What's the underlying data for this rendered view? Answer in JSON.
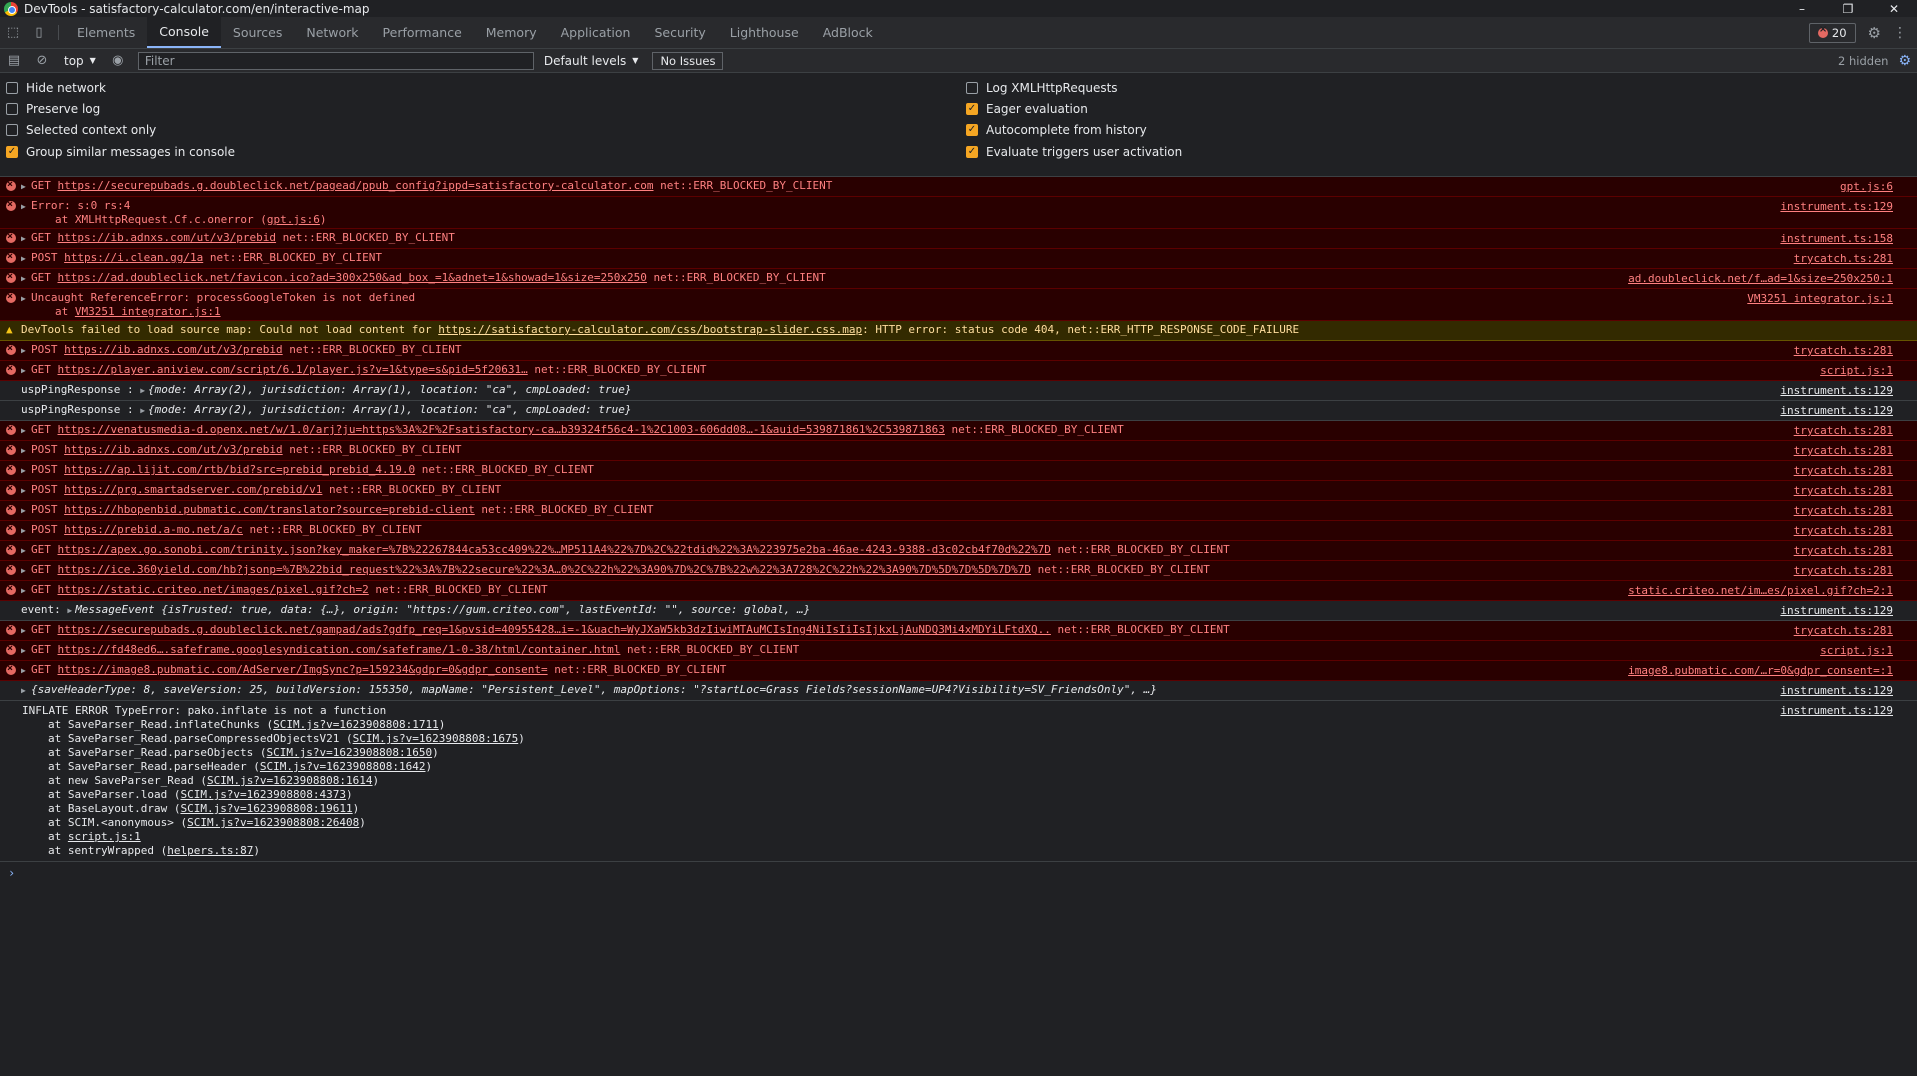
{
  "window": {
    "title": "DevTools - satisfactory-calculator.com/en/interactive-map",
    "controls": [
      "–",
      "❐",
      "✕"
    ]
  },
  "tabs": [
    "Elements",
    "Console",
    "Sources",
    "Network",
    "Performance",
    "Memory",
    "Application",
    "Security",
    "Lighthouse",
    "AdBlock"
  ],
  "active_tab": "Console",
  "error_count": "20",
  "toolbar": {
    "context": "top",
    "filter_placeholder": "Filter",
    "levels": "Default levels",
    "issues": "No Issues",
    "hidden": "2 hidden"
  },
  "settings": {
    "left": [
      {
        "label": "Hide network",
        "checked": false
      },
      {
        "label": "Preserve log",
        "checked": false
      },
      {
        "label": "Selected context only",
        "checked": false
      },
      {
        "label": "Group similar messages in console",
        "checked": true
      }
    ],
    "right": [
      {
        "label": "Log XMLHttpRequests",
        "checked": false
      },
      {
        "label": "Eager evaluation",
        "checked": true
      },
      {
        "label": "Autocomplete from history",
        "checked": true
      },
      {
        "label": "Evaluate triggers user activation",
        "checked": true
      }
    ]
  },
  "console": [
    {
      "type": "error",
      "method": "GET",
      "url": "https://securepubads.g.doubleclick.net/pagead/ppub_config?ippd=satisfactory-calculator.com",
      "tail": " net::ERR_BLOCKED_BY_CLIENT",
      "src": "gpt.js:6"
    },
    {
      "type": "error",
      "text": "Error: s:0 rs:4",
      "sub": "at XMLHttpRequest.Cf.c.onerror (",
      "sub_link": "gpt.js:6",
      "sub_end": ")",
      "src": "instrument.ts:129"
    },
    {
      "type": "error",
      "method": "GET",
      "url": "https://ib.adnxs.com/ut/v3/prebid",
      "tail": " net::ERR_BLOCKED_BY_CLIENT",
      "src": "instrument.ts:158"
    },
    {
      "type": "error",
      "method": "POST",
      "url": "https://i.clean.gg/1a",
      "tail": " net::ERR_BLOCKED_BY_CLIENT",
      "src": "trycatch.ts:281"
    },
    {
      "type": "error",
      "method": "GET",
      "url": "https://ad.doubleclick.net/favicon.ico?ad=300x250&ad_box_=1&adnet=1&showad=1&size=250x250",
      "tail": " net::ERR_BLOCKED_BY_CLIENT",
      "src": "ad.doubleclick.net/f…ad=1&size=250x250:1"
    },
    {
      "type": "error",
      "text": "Uncaught ReferenceError: processGoogleToken is not defined",
      "sub": "at ",
      "sub_link": "VM3251 integrator.js:1",
      "sub_end": "",
      "src": "VM3251 integrator.js:1"
    },
    {
      "type": "warn",
      "text": "DevTools failed to load source map: Could not load content for ",
      "url": "https://satisfactory-calculator.com/css/bootstrap-slider.css.map",
      "tail": ": HTTP error: status code 404, net::ERR_HTTP_RESPONSE_CODE_FAILURE"
    },
    {
      "type": "error",
      "method": "POST",
      "url": "https://ib.adnxs.com/ut/v3/prebid",
      "tail": " net::ERR_BLOCKED_BY_CLIENT",
      "src": "trycatch.ts:281"
    },
    {
      "type": "error",
      "method": "GET",
      "url": "https://player.aniview.com/script/6.1/player.js?v=1&type=s&pid=5f20631…",
      "tail": " net::ERR_BLOCKED_BY_CLIENT",
      "src": "script.js:1"
    },
    {
      "type": "log",
      "label": "uspPingResponse : ",
      "obj": "{mode: Array(2), jurisdiction: Array(1), location: \"ca\", cmpLoaded: true}",
      "src": "instrument.ts:129"
    },
    {
      "type": "log",
      "label": "uspPingResponse : ",
      "obj": "{mode: Array(2), jurisdiction: Array(1), location: \"ca\", cmpLoaded: true}",
      "src": "instrument.ts:129"
    },
    {
      "type": "error",
      "method": "GET",
      "url": "https://venatusmedia-d.openx.net/w/1.0/arj?ju=https%3A%2F%2Fsatisfactory-ca…b39324f56c4-1%2C1003-606dd08…-1&auid=539871861%2C539871863",
      "tail": " net::ERR_BLOCKED_BY_CLIENT",
      "src": "trycatch.ts:281"
    },
    {
      "type": "error",
      "method": "POST",
      "url": "https://ib.adnxs.com/ut/v3/prebid",
      "tail": " net::ERR_BLOCKED_BY_CLIENT",
      "src": "trycatch.ts:281"
    },
    {
      "type": "error",
      "method": "POST",
      "url": "https://ap.lijit.com/rtb/bid?src=prebid_prebid_4.19.0",
      "tail": " net::ERR_BLOCKED_BY_CLIENT",
      "src": "trycatch.ts:281"
    },
    {
      "type": "error",
      "method": "POST",
      "url": "https://prg.smartadserver.com/prebid/v1",
      "tail": " net::ERR_BLOCKED_BY_CLIENT",
      "src": "trycatch.ts:281"
    },
    {
      "type": "error",
      "method": "POST",
      "url": "https://hbopenbid.pubmatic.com/translator?source=prebid-client",
      "tail": " net::ERR_BLOCKED_BY_CLIENT",
      "src": "trycatch.ts:281"
    },
    {
      "type": "error",
      "method": "POST",
      "url": "https://prebid.a-mo.net/a/c",
      "tail": " net::ERR_BLOCKED_BY_CLIENT",
      "src": "trycatch.ts:281"
    },
    {
      "type": "error",
      "method": "GET",
      "url": "https://apex.go.sonobi.com/trinity.json?key_maker=%7B%22267844ca53cc409%22%…MP511A4%22%7D%2C%22tdid%22%3A%223975e2ba-46ae-4243-9388-d3c02cb4f70d%22%7D",
      "tail": " net::ERR_BLOCKED_BY_CLIENT",
      "src": "trycatch.ts:281"
    },
    {
      "type": "error",
      "method": "GET",
      "url": "https://ice.360yield.com/hb?jsonp=%7B%22bid_request%22%3A%7B%22secure%22%3A…0%2C%22h%22%3A90%7D%2C%7B%22w%22%3A728%2C%22h%22%3A90%7D%5D%7D%5D%7D%7D",
      "tail": " net::ERR_BLOCKED_BY_CLIENT",
      "src": "trycatch.ts:281"
    },
    {
      "type": "error",
      "method": "GET",
      "url": "https://static.criteo.net/images/pixel.gif?ch=2",
      "tail": " net::ERR_BLOCKED_BY_CLIENT",
      "src": "static.criteo.net/im…es/pixel.gif?ch=2:1"
    },
    {
      "type": "log",
      "label": "event: ",
      "obj": "MessageEvent {isTrusted: true, data: {…}, origin: \"https://gum.criteo.com\", lastEventId: \"\", source: global, …}",
      "src": "instrument.ts:129"
    },
    {
      "type": "error",
      "method": "GET",
      "url": "https://securepubads.g.doubleclick.net/gampad/ads?gdfp_req=1&pvsid=40955428…i=-1&uach=WyJXaW5kb3dzIiwiMTAuMCIsIng4NiIsIiIsIjkxLjAuNDQ3Mi4xMDYiLFtdXQ..",
      "tail": " net::ERR_BLOCKED_BY_CLIENT",
      "src": "trycatch.ts:281"
    },
    {
      "type": "error",
      "method": "GET",
      "url": "https://fd48ed6….safeframe.googlesyndication.com/safeframe/1-0-38/html/container.html",
      "tail": " net::ERR_BLOCKED_BY_CLIENT",
      "src": "script.js:1"
    },
    {
      "type": "error",
      "method": "GET",
      "url": "https://image8.pubmatic.com/AdServer/ImgSync?p=159234&gdpr=0&gdpr_consent=",
      "tail": " net::ERR_BLOCKED_BY_CLIENT",
      "src": "image8.pubmatic.com/…r=0&gdpr_consent=:1"
    },
    {
      "type": "log",
      "label": "",
      "obj": "{saveHeaderType: 8, saveVersion: 25, buildVersion: 155350, mapName: \"Persistent_Level\", mapOptions: \"?startLoc=Grass Fields?sessionName=UP4?Visibility=SV_FriendsOnly\", …}",
      "src": "instrument.ts:129"
    }
  ],
  "inflate_error": {
    "head": "INFLATE ERROR TypeError: pako.inflate is not a function",
    "src": "instrument.ts:129",
    "stack": [
      {
        "pre": "at SaveParser_Read.inflateChunks (",
        "link": "SCIM.js?v=1623908808:1711",
        "post": ")"
      },
      {
        "pre": "at SaveParser_Read.parseCompressedObjectsV21 (",
        "link": "SCIM.js?v=1623908808:1675",
        "post": ")"
      },
      {
        "pre": "at SaveParser_Read.parseObjects (",
        "link": "SCIM.js?v=1623908808:1650",
        "post": ")"
      },
      {
        "pre": "at SaveParser_Read.parseHeader (",
        "link": "SCIM.js?v=1623908808:1642",
        "post": ")"
      },
      {
        "pre": "at new SaveParser_Read (",
        "link": "SCIM.js?v=1623908808:1614",
        "post": ")"
      },
      {
        "pre": "at SaveParser.load (",
        "link": "SCIM.js?v=1623908808:4373",
        "post": ")"
      },
      {
        "pre": "at BaseLayout.draw (",
        "link": "SCIM.js?v=1623908808:19611",
        "post": ")"
      },
      {
        "pre": "at SCIM.<anonymous> (",
        "link": "SCIM.js?v=1623908808:26408",
        "post": ")"
      },
      {
        "pre": "at ",
        "link": "script.js:1",
        "post": ""
      },
      {
        "pre": "at sentryWrapped (",
        "link": "helpers.ts:87",
        "post": ")"
      }
    ]
  },
  "prompt_symbol": "›",
  "icons": {
    "inspect": "⬚",
    "device": "▯",
    "sidebar": "▤",
    "clear": "⊘",
    "eye": "◉",
    "gear": "⚙",
    "more": "⋮",
    "error": "⊗",
    "warning": "▲",
    "expand": "▶"
  },
  "colors": {
    "error_bg": "#290000",
    "error_text": "#ff8080",
    "warn_bg": "#332a00",
    "warn_text": "#ffdd9e",
    "accent": "#8ab4f8",
    "checkbox": "#f5a623"
  }
}
